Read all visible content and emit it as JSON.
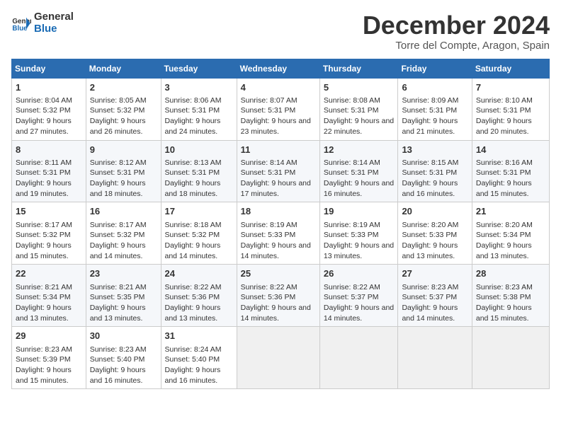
{
  "logo": {
    "line1": "General",
    "line2": "Blue"
  },
  "title": "December 2024",
  "subtitle": "Torre del Compte, Aragon, Spain",
  "headers": [
    "Sunday",
    "Monday",
    "Tuesday",
    "Wednesday",
    "Thursday",
    "Friday",
    "Saturday"
  ],
  "weeks": [
    [
      {
        "day": "1",
        "sunrise": "Sunrise: 8:04 AM",
        "sunset": "Sunset: 5:32 PM",
        "daylight": "Daylight: 9 hours and 27 minutes."
      },
      {
        "day": "2",
        "sunrise": "Sunrise: 8:05 AM",
        "sunset": "Sunset: 5:32 PM",
        "daylight": "Daylight: 9 hours and 26 minutes."
      },
      {
        "day": "3",
        "sunrise": "Sunrise: 8:06 AM",
        "sunset": "Sunset: 5:31 PM",
        "daylight": "Daylight: 9 hours and 24 minutes."
      },
      {
        "day": "4",
        "sunrise": "Sunrise: 8:07 AM",
        "sunset": "Sunset: 5:31 PM",
        "daylight": "Daylight: 9 hours and 23 minutes."
      },
      {
        "day": "5",
        "sunrise": "Sunrise: 8:08 AM",
        "sunset": "Sunset: 5:31 PM",
        "daylight": "Daylight: 9 hours and 22 minutes."
      },
      {
        "day": "6",
        "sunrise": "Sunrise: 8:09 AM",
        "sunset": "Sunset: 5:31 PM",
        "daylight": "Daylight: 9 hours and 21 minutes."
      },
      {
        "day": "7",
        "sunrise": "Sunrise: 8:10 AM",
        "sunset": "Sunset: 5:31 PM",
        "daylight": "Daylight: 9 hours and 20 minutes."
      }
    ],
    [
      {
        "day": "8",
        "sunrise": "Sunrise: 8:11 AM",
        "sunset": "Sunset: 5:31 PM",
        "daylight": "Daylight: 9 hours and 19 minutes."
      },
      {
        "day": "9",
        "sunrise": "Sunrise: 8:12 AM",
        "sunset": "Sunset: 5:31 PM",
        "daylight": "Daylight: 9 hours and 18 minutes."
      },
      {
        "day": "10",
        "sunrise": "Sunrise: 8:13 AM",
        "sunset": "Sunset: 5:31 PM",
        "daylight": "Daylight: 9 hours and 18 minutes."
      },
      {
        "day": "11",
        "sunrise": "Sunrise: 8:14 AM",
        "sunset": "Sunset: 5:31 PM",
        "daylight": "Daylight: 9 hours and 17 minutes."
      },
      {
        "day": "12",
        "sunrise": "Sunrise: 8:14 AM",
        "sunset": "Sunset: 5:31 PM",
        "daylight": "Daylight: 9 hours and 16 minutes."
      },
      {
        "day": "13",
        "sunrise": "Sunrise: 8:15 AM",
        "sunset": "Sunset: 5:31 PM",
        "daylight": "Daylight: 9 hours and 16 minutes."
      },
      {
        "day": "14",
        "sunrise": "Sunrise: 8:16 AM",
        "sunset": "Sunset: 5:31 PM",
        "daylight": "Daylight: 9 hours and 15 minutes."
      }
    ],
    [
      {
        "day": "15",
        "sunrise": "Sunrise: 8:17 AM",
        "sunset": "Sunset: 5:32 PM",
        "daylight": "Daylight: 9 hours and 15 minutes."
      },
      {
        "day": "16",
        "sunrise": "Sunrise: 8:17 AM",
        "sunset": "Sunset: 5:32 PM",
        "daylight": "Daylight: 9 hours and 14 minutes."
      },
      {
        "day": "17",
        "sunrise": "Sunrise: 8:18 AM",
        "sunset": "Sunset: 5:32 PM",
        "daylight": "Daylight: 9 hours and 14 minutes."
      },
      {
        "day": "18",
        "sunrise": "Sunrise: 8:19 AM",
        "sunset": "Sunset: 5:33 PM",
        "daylight": "Daylight: 9 hours and 14 minutes."
      },
      {
        "day": "19",
        "sunrise": "Sunrise: 8:19 AM",
        "sunset": "Sunset: 5:33 PM",
        "daylight": "Daylight: 9 hours and 13 minutes."
      },
      {
        "day": "20",
        "sunrise": "Sunrise: 8:20 AM",
        "sunset": "Sunset: 5:33 PM",
        "daylight": "Daylight: 9 hours and 13 minutes."
      },
      {
        "day": "21",
        "sunrise": "Sunrise: 8:20 AM",
        "sunset": "Sunset: 5:34 PM",
        "daylight": "Daylight: 9 hours and 13 minutes."
      }
    ],
    [
      {
        "day": "22",
        "sunrise": "Sunrise: 8:21 AM",
        "sunset": "Sunset: 5:34 PM",
        "daylight": "Daylight: 9 hours and 13 minutes."
      },
      {
        "day": "23",
        "sunrise": "Sunrise: 8:21 AM",
        "sunset": "Sunset: 5:35 PM",
        "daylight": "Daylight: 9 hours and 13 minutes."
      },
      {
        "day": "24",
        "sunrise": "Sunrise: 8:22 AM",
        "sunset": "Sunset: 5:36 PM",
        "daylight": "Daylight: 9 hours and 13 minutes."
      },
      {
        "day": "25",
        "sunrise": "Sunrise: 8:22 AM",
        "sunset": "Sunset: 5:36 PM",
        "daylight": "Daylight: 9 hours and 14 minutes."
      },
      {
        "day": "26",
        "sunrise": "Sunrise: 8:22 AM",
        "sunset": "Sunset: 5:37 PM",
        "daylight": "Daylight: 9 hours and 14 minutes."
      },
      {
        "day": "27",
        "sunrise": "Sunrise: 8:23 AM",
        "sunset": "Sunset: 5:37 PM",
        "daylight": "Daylight: 9 hours and 14 minutes."
      },
      {
        "day": "28",
        "sunrise": "Sunrise: 8:23 AM",
        "sunset": "Sunset: 5:38 PM",
        "daylight": "Daylight: 9 hours and 15 minutes."
      }
    ],
    [
      {
        "day": "29",
        "sunrise": "Sunrise: 8:23 AM",
        "sunset": "Sunset: 5:39 PM",
        "daylight": "Daylight: 9 hours and 15 minutes."
      },
      {
        "day": "30",
        "sunrise": "Sunrise: 8:23 AM",
        "sunset": "Sunset: 5:40 PM",
        "daylight": "Daylight: 9 hours and 16 minutes."
      },
      {
        "day": "31",
        "sunrise": "Sunrise: 8:24 AM",
        "sunset": "Sunset: 5:40 PM",
        "daylight": "Daylight: 9 hours and 16 minutes."
      },
      null,
      null,
      null,
      null
    ]
  ]
}
